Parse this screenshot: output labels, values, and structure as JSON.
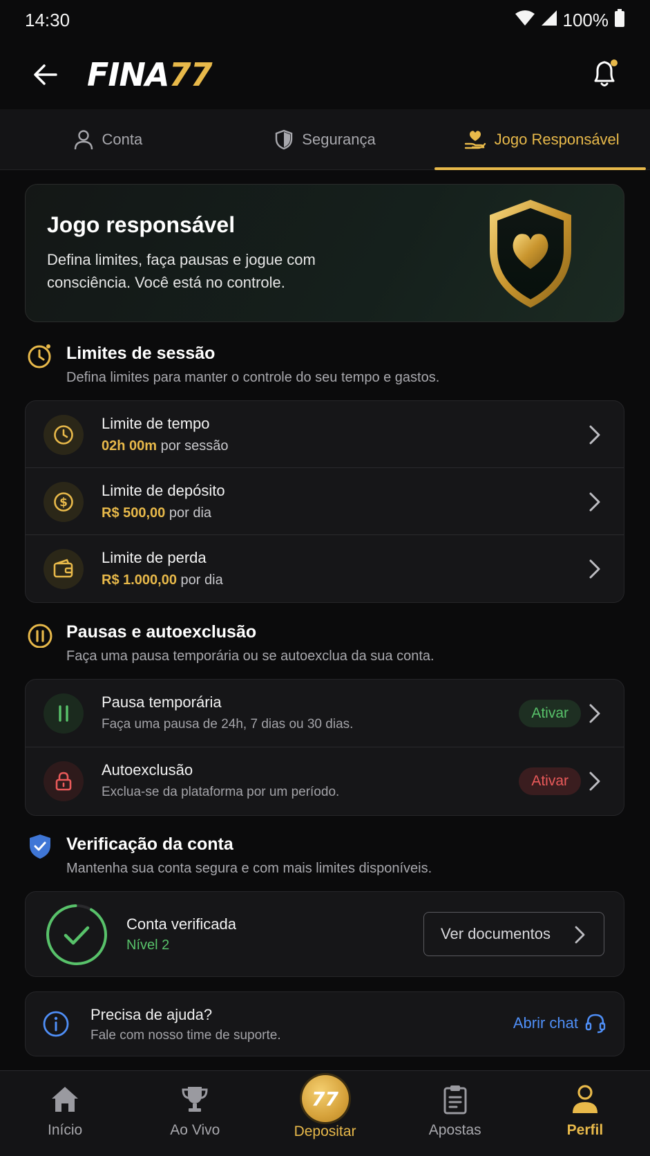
{
  "status": {
    "time": "14:30",
    "battery": "100%"
  },
  "header": {
    "logo_white": "FINA",
    "logo_gold": "77"
  },
  "tabs": [
    {
      "label": "Conta",
      "icon": "user-icon"
    },
    {
      "label": "Segurança",
      "icon": "shield-icon"
    },
    {
      "label": "Jogo Responsável",
      "icon": "heart-hand-icon",
      "active": true
    }
  ],
  "hero": {
    "title": "Jogo responsável",
    "description": "Defina limites, faça pausas e jogue com consciência. Você está no controle."
  },
  "limits": {
    "title": "Limites de sessão",
    "subtitle": "Defina limites para manter o controle do seu tempo e gastos.",
    "items": [
      {
        "title": "Limite de tempo",
        "value": "02h 00m",
        "suffix": "por sessão",
        "icon": "clock-icon"
      },
      {
        "title": "Limite de depósito",
        "value": "R$ 500,00",
        "suffix": "por dia",
        "icon": "dollar-coin-icon"
      },
      {
        "title": "Limite de perda",
        "value": "R$ 1.000,00",
        "suffix": "por dia",
        "icon": "wallet-icon"
      }
    ]
  },
  "pauses": {
    "title": "Pausas e autoexclusão",
    "subtitle": "Faça uma pausa temporária ou se autoexclua da sua conta.",
    "items": [
      {
        "title": "Pausa temporária",
        "description": "Faça uma pausa de 24h, 7 dias ou 30 dias.",
        "action": "Ativar",
        "icon": "pause-icon"
      },
      {
        "title": "Autoexclusão",
        "description": "Exclua-se da plataforma por um período.",
        "action": "Ativar",
        "icon": "lock-icon"
      }
    ]
  },
  "verification": {
    "title": "Verificação da conta",
    "subtitle": "Mantenha sua conta segura e com mais limites disponíveis.",
    "status": "Conta verificada",
    "level": "Nível 2",
    "button": "Ver documentos"
  },
  "help": {
    "title": "Precisa de ajuda?",
    "subtitle": "Fale com nosso time de suporte.",
    "link": "Abrir chat"
  },
  "bottom_nav": [
    {
      "label": "Início",
      "icon": "home-icon"
    },
    {
      "label": "Ao Vivo",
      "icon": "trophy-icon"
    },
    {
      "label": "Depositar",
      "icon": "deposit-coin-icon",
      "coin_text": "77"
    },
    {
      "label": "Apostas",
      "icon": "clipboard-icon"
    },
    {
      "label": "Perfil",
      "icon": "profile-icon",
      "active": true
    }
  ],
  "colors": {
    "accent": "#e8b94a",
    "success": "#58c26a",
    "danger": "#ea5a5a",
    "link": "#4f8ff7",
    "background": "#0b0b0c"
  }
}
